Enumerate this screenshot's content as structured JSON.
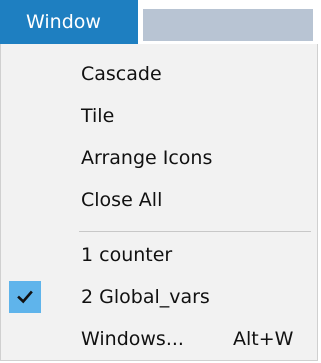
{
  "menubar": {
    "title": "Window"
  },
  "menu": {
    "items": [
      {
        "label": "Cascade"
      },
      {
        "label": "Tile"
      },
      {
        "label": "Arrange Icons"
      },
      {
        "label": "Close All"
      },
      {
        "label": "1 counter"
      },
      {
        "label": "2 Global_vars",
        "checked": true
      },
      {
        "label": "Windows...",
        "shortcut": "Alt+W"
      }
    ]
  },
  "colors": {
    "menubar_active": "#1e7fc1",
    "checked_highlight": "#5fb4eb",
    "menu_background": "#f2f2f2"
  }
}
